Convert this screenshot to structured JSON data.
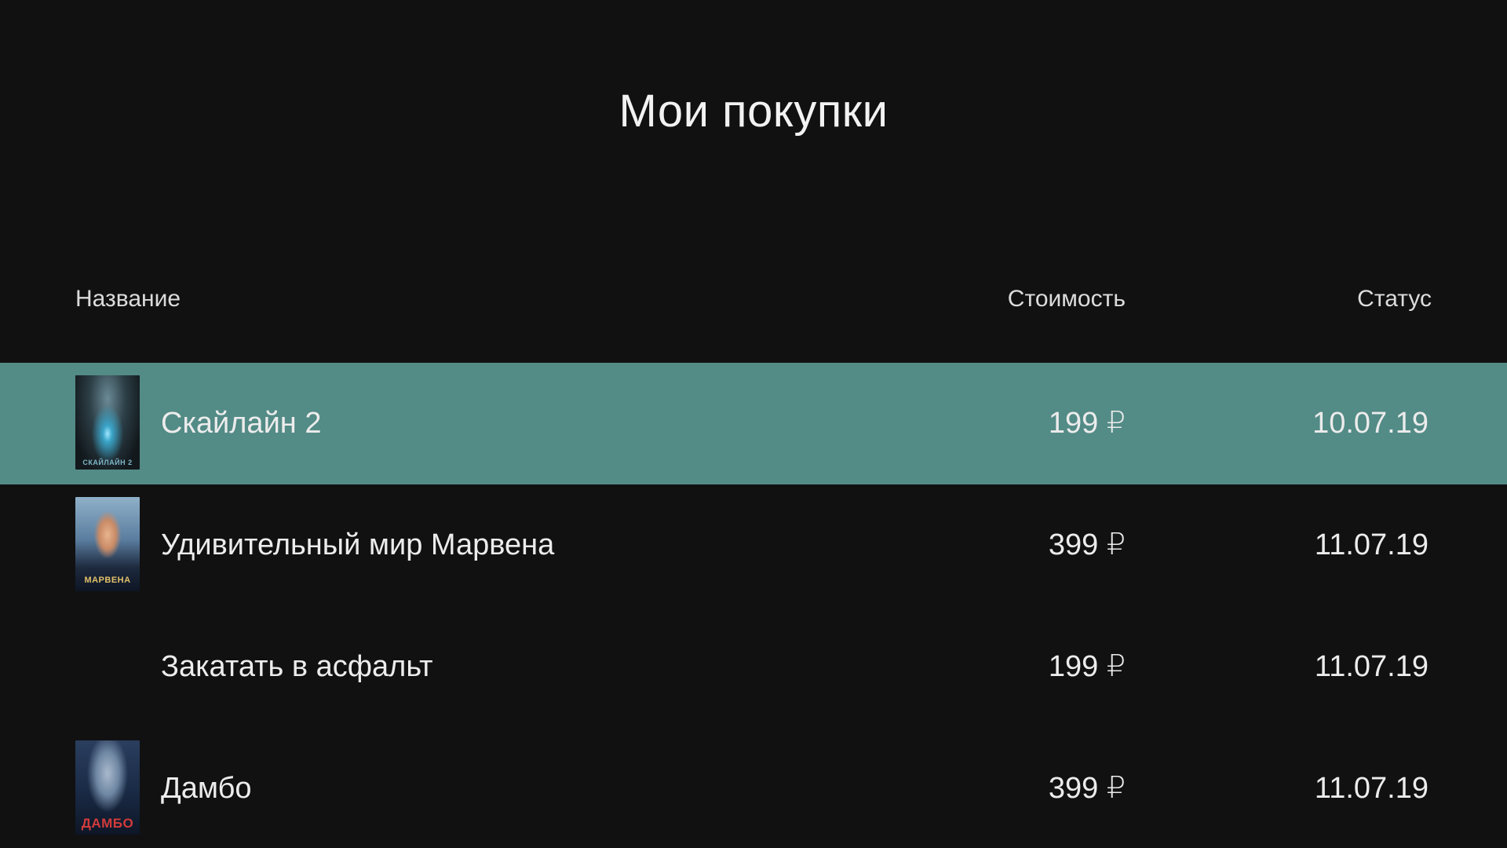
{
  "page": {
    "title": "Мои покупки"
  },
  "table": {
    "headers": {
      "name": "Название",
      "price": "Стоимость",
      "status": "Статус"
    },
    "rows": [
      {
        "title": "Скайлайн 2",
        "price": "199 ₽",
        "status": "10.07.19",
        "poster_caption": "СКАЙЛАЙН 2",
        "selected": true
      },
      {
        "title": "Удивительный мир Марвена",
        "price": "399 ₽",
        "status": "11.07.19",
        "poster_caption": "МАРВЕНА",
        "selected": false
      },
      {
        "title": "Закатать в асфальт",
        "price": "199 ₽",
        "status": "11.07.19",
        "poster_caption": "",
        "selected": false
      },
      {
        "title": "Дамбо",
        "price": "399 ₽",
        "status": "11.07.19",
        "poster_caption": "ДАМБО",
        "selected": false
      }
    ]
  },
  "colors": {
    "background": "#111112",
    "selected_row": "#538b86",
    "text": "#ececec"
  }
}
